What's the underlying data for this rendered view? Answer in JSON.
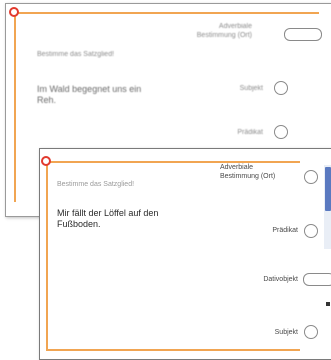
{
  "back_card": {
    "prompt": "Bestimme das Satzglied!",
    "sentence": "Im Wald begegnet uns ein Reh.",
    "options": [
      "Adverbiale Bestimmung (Ort)",
      "Subjekt",
      "Prädikat"
    ]
  },
  "front_card": {
    "prompt": "Bestimme das Satzglied!",
    "sentence": "Mir fällt der Löffel auf den Fußboden.",
    "options": [
      "Adverbiale Bestimmung (Ort)",
      "Prädikat",
      "Dativobjekt",
      "Subjekt"
    ]
  },
  "accent_color": "#f1a552",
  "marker_color": "#e23a2d",
  "scroll_color": "#5a79c0"
}
